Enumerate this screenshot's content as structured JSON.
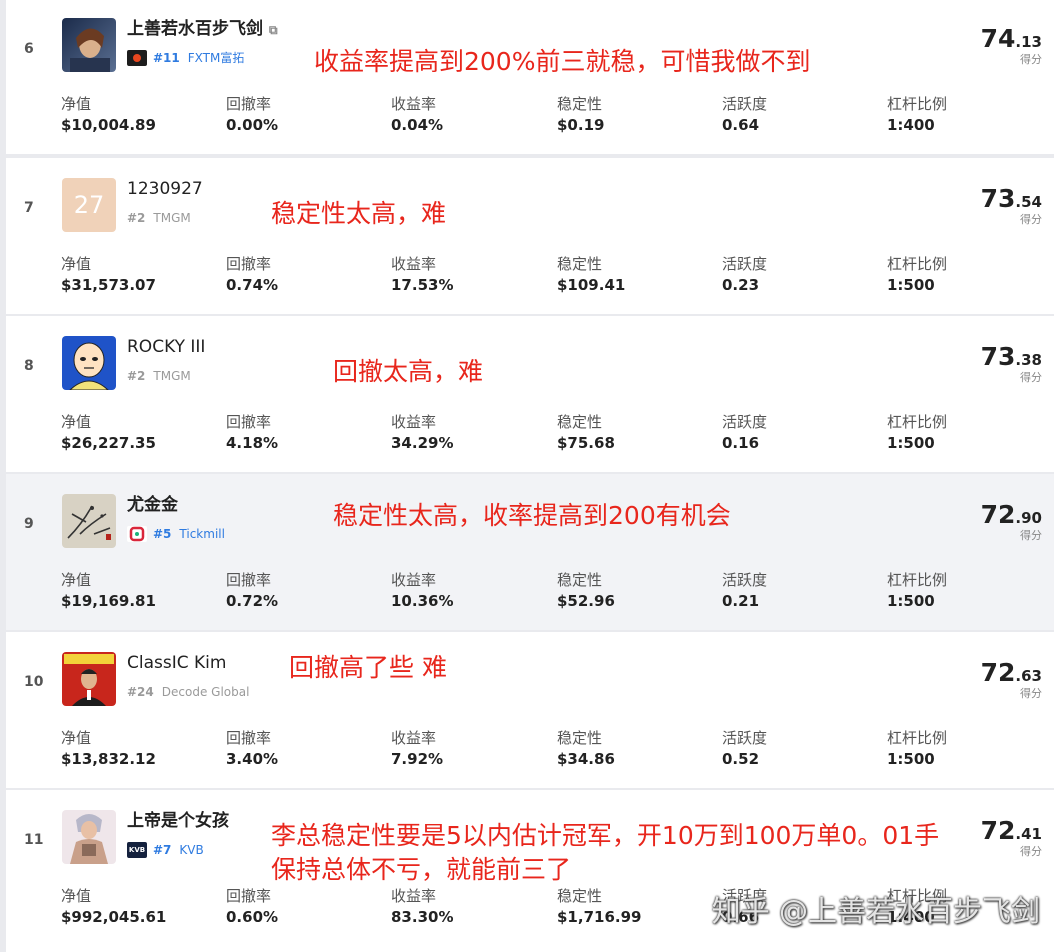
{
  "metric_labels": {
    "equity": "净值",
    "drawdown": "回撤率",
    "return": "收益率",
    "stability": "稳定性",
    "activity": "活跃度",
    "leverage": "杠杆比例"
  },
  "score_label": "得分",
  "rows": [
    {
      "rank": "6",
      "name": "上善若水百步飞剑",
      "has_link_icon": true,
      "broker_rank": "#11",
      "broker": "FXTM富拓",
      "score_int": "74",
      "score_dec": ".13",
      "equity": "$10,004.89",
      "drawdown": "0.00%",
      "return": "0.04%",
      "stability": "$0.19",
      "activity": "0.64",
      "leverage": "1:400",
      "note": "收益率提高到200%前三就稳，可惜我做不到"
    },
    {
      "rank": "7",
      "name": "1230927",
      "avatar_text": "27",
      "broker_rank": "#2",
      "broker": "TMGM",
      "score_int": "73",
      "score_dec": ".54",
      "equity": "$31,573.07",
      "drawdown": "0.74%",
      "return": "17.53%",
      "stability": "$109.41",
      "activity": "0.23",
      "leverage": "1:500",
      "note": "稳定性太高，难"
    },
    {
      "rank": "8",
      "name": "ROCKY III",
      "broker_rank": "#2",
      "broker": "TMGM",
      "score_int": "73",
      "score_dec": ".38",
      "equity": "$26,227.35",
      "drawdown": "4.18%",
      "return": "34.29%",
      "stability": "$75.68",
      "activity": "0.16",
      "leverage": "1:500",
      "note": "回撤太高，难"
    },
    {
      "rank": "9",
      "name": "尤金金",
      "broker_rank": "#5",
      "broker": "Tickmill",
      "score_int": "72",
      "score_dec": ".90",
      "equity": "$19,169.81",
      "drawdown": "0.72%",
      "return": "10.36%",
      "stability": "$52.96",
      "activity": "0.21",
      "leverage": "1:500",
      "note": "稳定性太高，收率提高到200有机会"
    },
    {
      "rank": "10",
      "name": "ClassIC Kim",
      "broker_rank": "#24",
      "broker": "Decode Global",
      "score_int": "72",
      "score_dec": ".63",
      "equity": "$13,832.12",
      "drawdown": "3.40%",
      "return": "7.92%",
      "stability": "$34.86",
      "activity": "0.52",
      "leverage": "1:500",
      "note": "回撤高了些 难"
    },
    {
      "rank": "11",
      "name": "上帝是个女孩",
      "broker_rank": "#7",
      "broker": "KVB",
      "score_int": "72",
      "score_dec": ".41",
      "equity": "$992,045.61",
      "drawdown": "0.60%",
      "return": "83.30%",
      "stability": "$1,716.99",
      "activity": "0.66",
      "leverage": "1:400",
      "note": "李总稳定性要是5以内估计冠军，开10万到100万单0。01手",
      "note2": "保持总体不亏，就能前三了"
    }
  ],
  "watermark": "知乎 @上善若水百步飞剑"
}
